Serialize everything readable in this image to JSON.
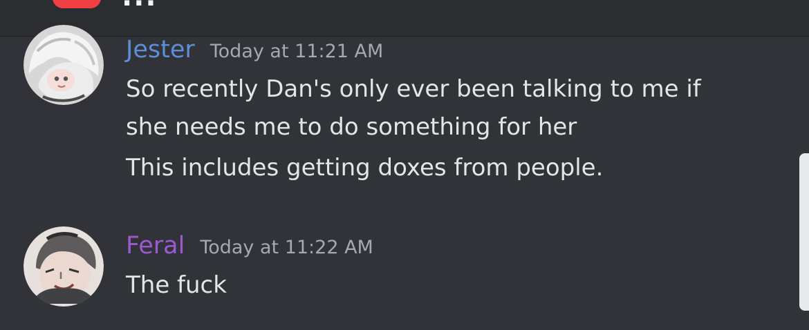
{
  "header": {
    "title": "..."
  },
  "messages": [
    {
      "author": "Jester",
      "author_color": "#5b8fd6",
      "timestamp": "Today at 11:21 AM",
      "lines": [
        "So recently Dan's only ever been talking to me if she needs me to do something for her",
        "This includes getting doxes from people."
      ]
    },
    {
      "author": "Feral",
      "author_color": "#9b5bd0",
      "timestamp": "Today at 11:22 AM",
      "lines": [
        "The fuck"
      ]
    }
  ],
  "colors": {
    "background": "#313338",
    "header_background": "#2b2d31",
    "notification_badge": "#f23f43",
    "timestamp": "#a5a9b0",
    "text": "#e3e5e8"
  }
}
